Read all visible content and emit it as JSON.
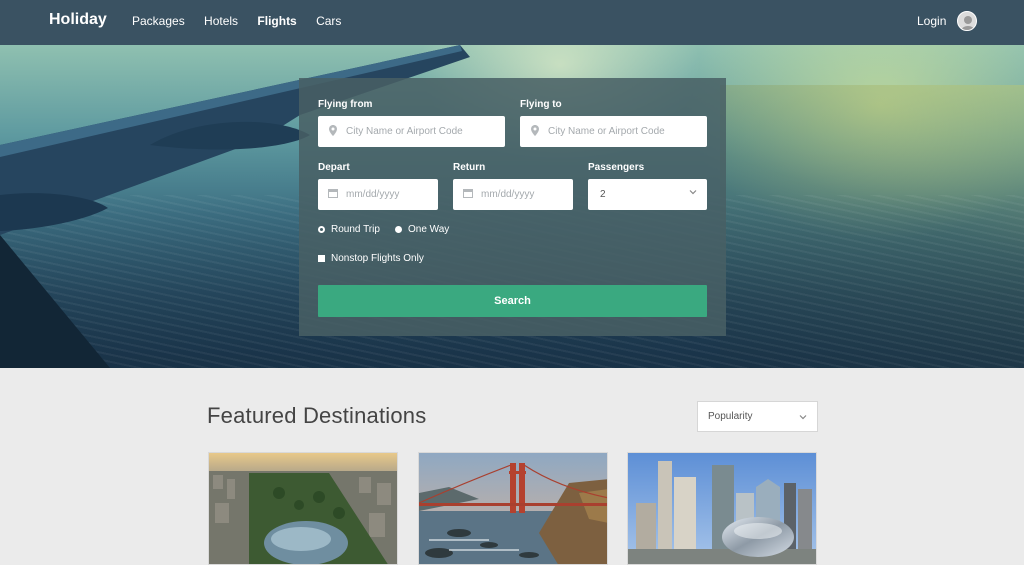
{
  "nav": {
    "brand": "Holiday",
    "links": [
      {
        "label": "Packages",
        "active": false
      },
      {
        "label": "Hotels",
        "active": false
      },
      {
        "label": "Flights",
        "active": true
      },
      {
        "label": "Cars",
        "active": false
      }
    ],
    "login": "Login"
  },
  "search": {
    "from_label": "Flying from",
    "from_placeholder": "City Name or Airport Code",
    "to_label": "Flying to",
    "to_placeholder": "City Name or Airport Code",
    "depart_label": "Depart",
    "depart_placeholder": "mm/dd/yyyy",
    "return_label": "Return",
    "return_placeholder": "mm/dd/yyyy",
    "passengers_label": "Passengers",
    "passengers_value": "2",
    "trip_options": [
      {
        "label": "Round Trip",
        "selected": false
      },
      {
        "label": "One Way",
        "selected": true
      }
    ],
    "nonstop_label": "Nonstop Flights Only",
    "nonstop_checked": true,
    "search_button": "Search"
  },
  "featured": {
    "title": "Featured Destinations",
    "sort_value": "Popularity",
    "cards": [
      {
        "image": "central-park-aerial"
      },
      {
        "image": "golden-gate-bridge"
      },
      {
        "image": "chicago-cloud-gate"
      }
    ]
  },
  "colors": {
    "nav_bg": "#3a5262",
    "accent": "#3aa980",
    "panel_bg": "#48606480",
    "page_bg": "#ebebeb"
  },
  "icons": {
    "location": "map-pin-icon",
    "calendar": "calendar-icon",
    "chevron": "chevron-down-icon",
    "avatar": "user-avatar-icon"
  }
}
